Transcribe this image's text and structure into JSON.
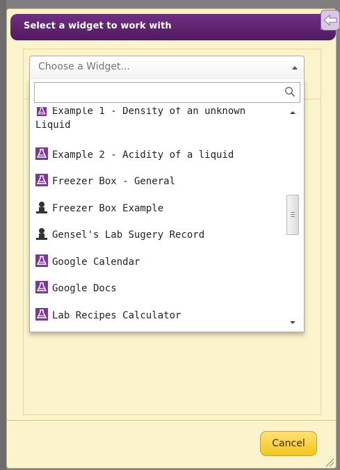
{
  "dialog": {
    "title": "Select a widget to work with",
    "close_glyph": "×"
  },
  "select": {
    "placeholder": "Choose a Widget..."
  },
  "search": {
    "value": "",
    "placeholder": ""
  },
  "items": [
    {
      "label": "Example 1 - Density of an unknown Liquid",
      "icon": "flask-icon"
    },
    {
      "label": "Example 2 - Acidity of a liquid",
      "icon": "flask-icon"
    },
    {
      "label": "Freezer Box - General",
      "icon": "flask-icon"
    },
    {
      "label": "Freezer Box Example",
      "icon": "person-icon"
    },
    {
      "label": "Gensel's Lab Sugery Record",
      "icon": "person-icon"
    },
    {
      "label": "Google Calendar",
      "icon": "flask-icon"
    },
    {
      "label": "Google Docs",
      "icon": "flask-icon"
    },
    {
      "label": "Lab Recipes Calculator",
      "icon": "flask-icon"
    }
  ],
  "footer": {
    "cancel_label": "Cancel"
  },
  "colors": {
    "title_bar": "#5e2270",
    "dialog_bg": "#fbf3cb",
    "flask_icon": "#7a3a92",
    "cancel_button": "#f7cf3a"
  }
}
